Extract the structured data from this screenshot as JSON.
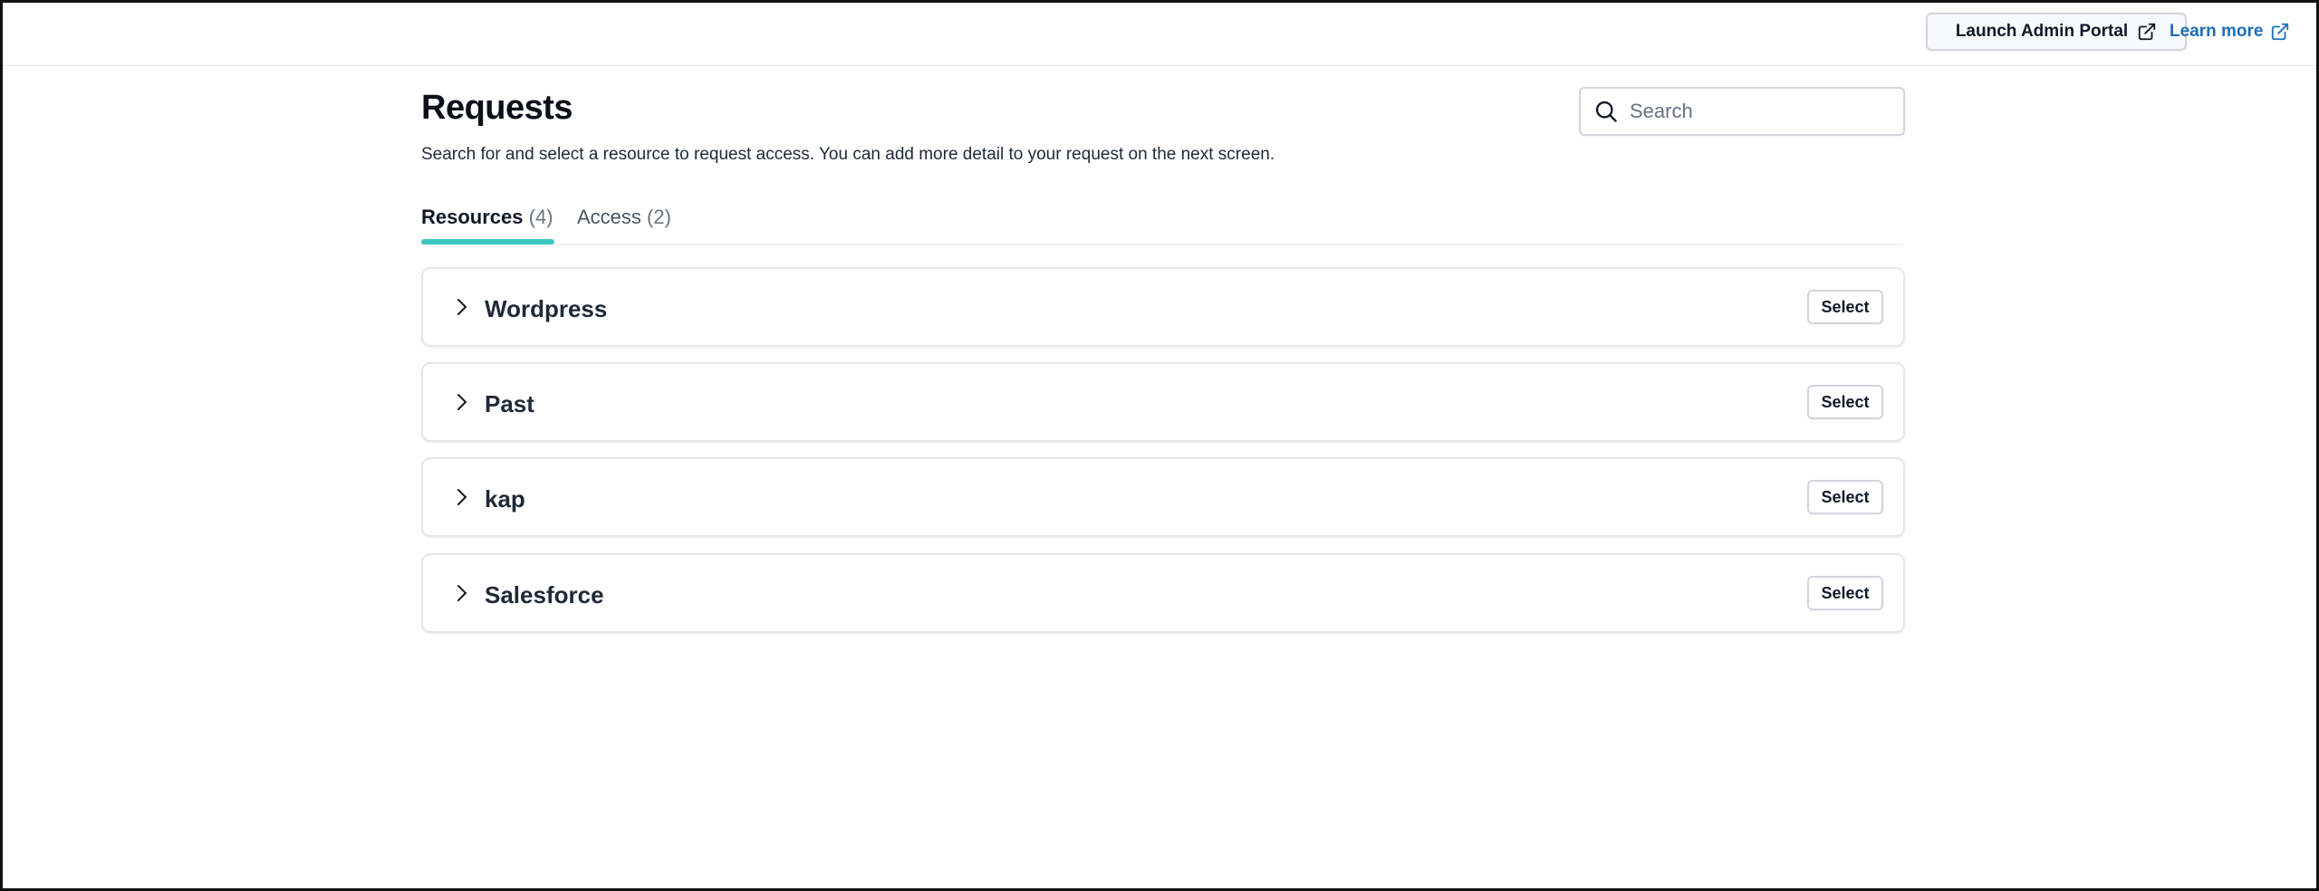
{
  "topbar": {
    "admin_portal_label": "Launch Admin Portal",
    "learn_more_label": "Learn more"
  },
  "header": {
    "title": "Requests",
    "description": "Search for and select a resource to request access. You can add more detail to your request on the next screen."
  },
  "search": {
    "placeholder": "Search",
    "value": ""
  },
  "tabs": [
    {
      "label": "Resources",
      "count": "(4)",
      "active": true
    },
    {
      "label": "Access",
      "count": "(2)",
      "active": false
    }
  ],
  "resources": [
    {
      "name": "Wordpress",
      "action": "Select"
    },
    {
      "name": "Past",
      "action": "Select"
    },
    {
      "name": "kap",
      "action": "Select"
    },
    {
      "name": "Salesforce",
      "action": "Select"
    }
  ],
  "colors": {
    "accent": "#3cc8c0",
    "link": "#1d6fb8"
  },
  "icons": {
    "external": "external-link-icon",
    "search": "search-icon",
    "expand": "chevron-right-icon"
  }
}
